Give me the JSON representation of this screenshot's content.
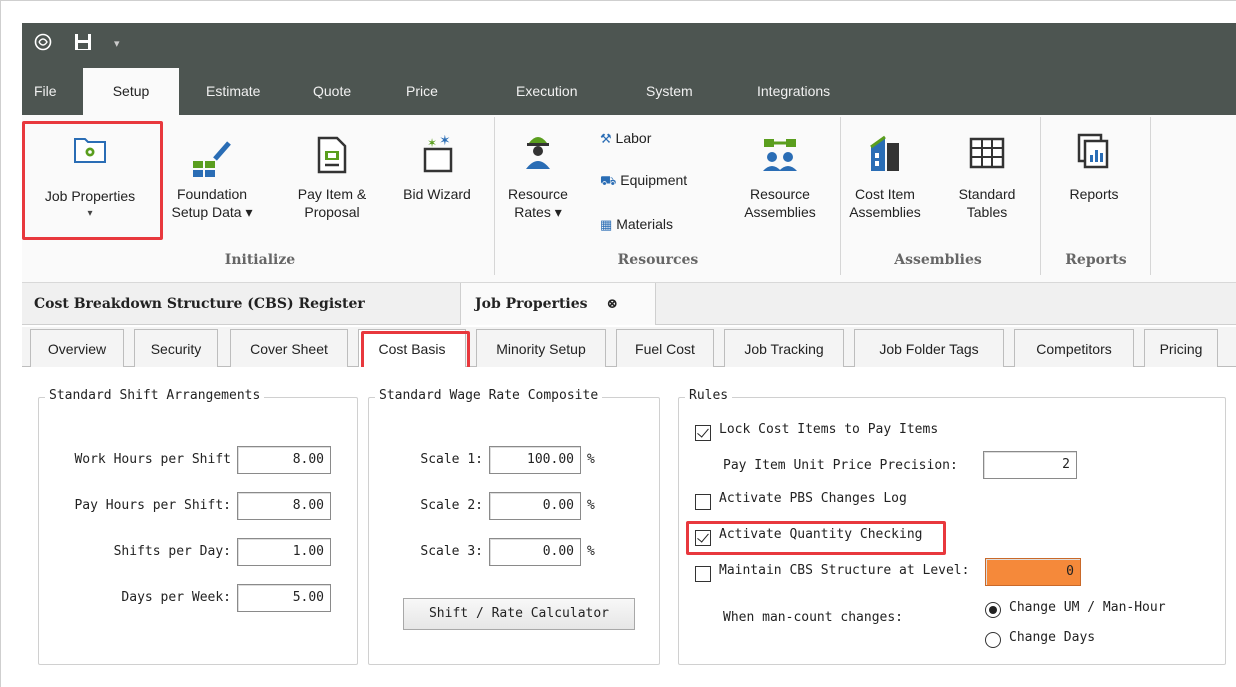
{
  "titlebar": {
    "app_icon": "app-logo-icon",
    "save_icon": "save-icon",
    "dropdown_icon": "chevron-down-icon"
  },
  "menu": {
    "items": [
      "File",
      "Setup",
      "Estimate",
      "Quote",
      "Price",
      "Execution",
      "System",
      "Integrations"
    ],
    "active": "Setup"
  },
  "ribbon": {
    "job_properties": {
      "line1": "Job Properties",
      "arrow": "▾"
    },
    "foundation": {
      "line1": "Foundation",
      "line2": "Setup Data ▾"
    },
    "pay_item": {
      "line1": "Pay Item &",
      "line2": "Proposal"
    },
    "bid_wizard": {
      "line1": "Bid Wizard"
    },
    "resource_rates": {
      "line1": "Resource",
      "line2": "Rates ▾"
    },
    "labor": "Labor",
    "equipment": "Equipment",
    "materials": "Materials",
    "resource_assemblies": {
      "line1": "Resource",
      "line2": "Assemblies"
    },
    "cost_item_assemblies": {
      "line1": "Cost Item",
      "line2": "Assemblies"
    },
    "standard_tables": {
      "line1": "Standard",
      "line2": "Tables"
    },
    "reports": {
      "line1": "Reports"
    },
    "groups": {
      "initialize": "Initialize",
      "resources": "Resources",
      "assemblies": "Assemblies",
      "reports": "Reports"
    },
    "colors": {
      "accent_green": "#5a9e1e",
      "icon_blue": "#2a6db5"
    }
  },
  "doc_tabs": {
    "cbs": "Cost Breakdown Structure (CBS) Register",
    "job": "Job Properties",
    "close": "⊗"
  },
  "sub_tabs": [
    "Overview",
    "Security",
    "Cover Sheet",
    "Cost Basis",
    "Minority Setup",
    "Fuel Cost",
    "Job Tracking",
    "Job Folder Tags",
    "Competitors",
    "Pricing"
  ],
  "shift": {
    "title": "Standard Shift Arrangements",
    "work_hours_label": "Work Hours per Shift",
    "work_hours": "8.00",
    "pay_hours_label": "Pay Hours per Shift:",
    "pay_hours": "8.00",
    "shifts_label": "Shifts per Day:",
    "shifts": "1.00",
    "days_label": "Days per Week:",
    "days": "5.00"
  },
  "wage": {
    "title": "Standard Wage Rate Composite",
    "scale1_label": "Scale 1:",
    "scale1": "100.00",
    "scale2_label": "Scale 2:",
    "scale2": "0.00",
    "scale3_label": "Scale 3:",
    "scale3": "0.00",
    "pct": "%",
    "calc_button": "Shift / Rate Calculator"
  },
  "rules": {
    "title": "Rules",
    "lock_cost_items": "Lock Cost Items to Pay Items",
    "lock_checked": true,
    "precision_label": "Pay Item Unit Price Precision:",
    "precision": "2",
    "pbs_log": "Activate PBS Changes Log",
    "pbs_checked": false,
    "qty_checking": "Activate Quantity Checking",
    "qty_checked": true,
    "maintain_cbs": "Maintain CBS Structure at Level:",
    "maintain_checked": false,
    "cbs_level": "0",
    "cbs_level_color": "#f5893a",
    "man_count_label": "When man-count changes:",
    "opt_um": "Change UM / Man-Hour",
    "opt_days": "Change Days",
    "selected": "Change UM / Man-Hour"
  },
  "highlight_color": "#e8383d"
}
